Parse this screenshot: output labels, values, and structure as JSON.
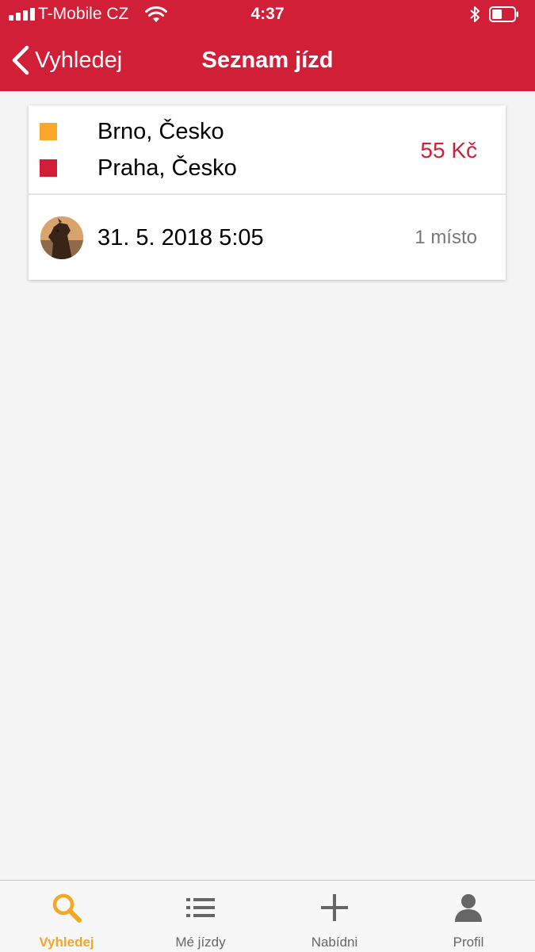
{
  "colors": {
    "brand_red": "#d21f38",
    "accent_orange": "#f5a623",
    "origin_marker": "#fba72a",
    "destination_marker": "#d21f38"
  },
  "status_bar": {
    "carrier": "T-Mobile CZ",
    "time": "4:37",
    "icons": [
      "cellular-signal-icon",
      "wifi-icon",
      "bluetooth-icon",
      "battery-icon"
    ]
  },
  "nav": {
    "back_label": "Vyhledej",
    "title": "Seznam jízd"
  },
  "ride": {
    "from": "Brno, Česko",
    "to": "Praha, Česko",
    "price": "55 Kč",
    "datetime": "31. 5. 2018 5:05",
    "seats": "1 místo"
  },
  "tabbar": {
    "items": [
      {
        "label": "Vyhledej",
        "icon": "search-icon",
        "active": true
      },
      {
        "label": "Mé jízdy",
        "icon": "list-icon",
        "active": false
      },
      {
        "label": "Nabídni",
        "icon": "plus-icon",
        "active": false
      },
      {
        "label": "Profil",
        "icon": "person-icon",
        "active": false
      }
    ]
  }
}
